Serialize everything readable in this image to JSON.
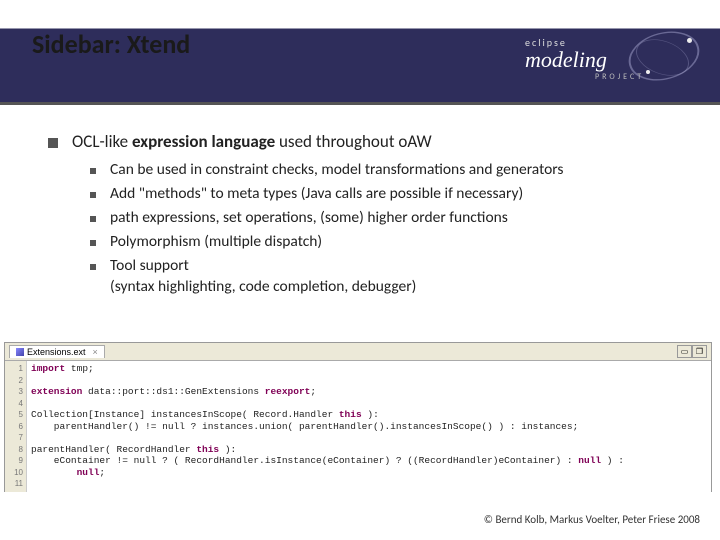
{
  "header": {
    "title": "Sidebar: Xtend",
    "logo": {
      "top": "eclipse",
      "main": "modeling",
      "sub": "PROJECT"
    }
  },
  "main": {
    "bullet_prefix": "OCL-like ",
    "bullet_bold": "expression language",
    "bullet_suffix": " used throughout oAW",
    "subs": [
      "Can be used in constraint checks, model transformations and generators",
      "Add \"methods\" to meta types (Java calls are possible if necessary)",
      "path expressions, set operations, (some)  higher order functions",
      "Polymorphism (multiple dispatch)",
      "Tool support\n(syntax highlighting, code completion, debugger)"
    ]
  },
  "ide": {
    "tab": "Extensions.ext",
    "tab_close": "×",
    "ctrl_min": "▭",
    "ctrl_max": "❐",
    "gutter": [
      "1",
      "2",
      "3",
      "4",
      "5",
      "6",
      "7",
      "8",
      "9",
      "10",
      "11"
    ],
    "code": {
      "l1a": "import",
      "l1b": " tmp;",
      "l3a": "extension",
      "l3b": " data::port::ds1::GenExtensions ",
      "l3c": "reexport",
      "l3d": ";",
      "l5a": "Collection[Instance] instancesInScope( Record.Handler ",
      "l5b": "this",
      "l5c": " ):",
      "l6": "    parentHandler() != null ? instances.union( parentHandler().instancesInScope() ) : instances;",
      "l8a": "parentHandler( RecordHandler ",
      "l8b": "this",
      "l8c": " ):",
      "l9a": "    eContainer != null ? ( RecordHandler.isInstance(eContainer) ? ((RecordHandler)eContainer) : ",
      "l9b": "null",
      "l9c": " ) :",
      "l10a": "        ",
      "l10b": "null",
      "l10c": ";"
    }
  },
  "footer": "© Bernd Kolb, Markus Voelter, Peter Friese 2008"
}
